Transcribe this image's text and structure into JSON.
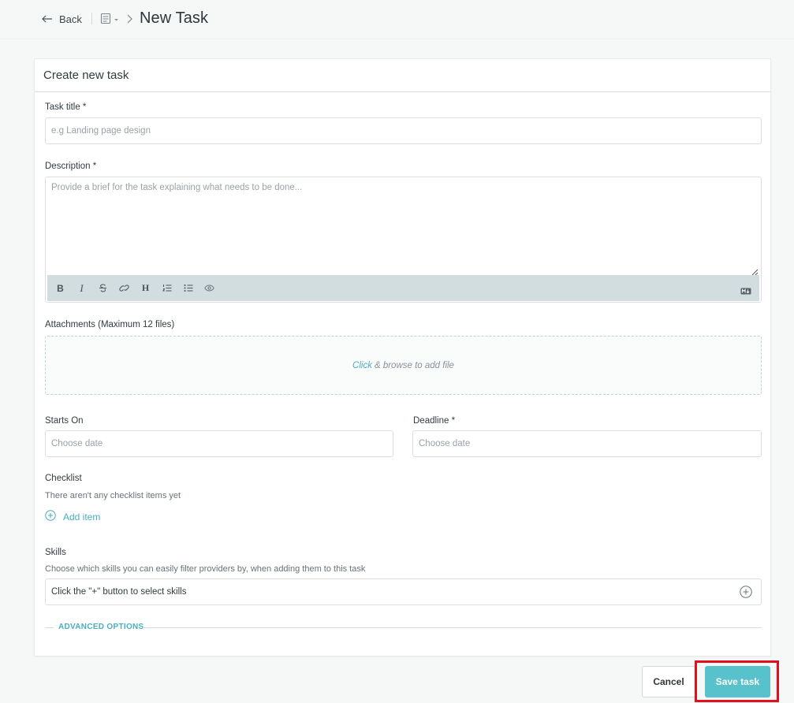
{
  "header": {
    "back_label": "Back",
    "title": "New Task"
  },
  "form": {
    "card_title": "Create new task",
    "task_title": {
      "label": "Task title *",
      "placeholder": "e.g Landing page design"
    },
    "description": {
      "label": "Description *",
      "placeholder": "Provide a brief for the task explaining what needs to be done...",
      "toolbar": {
        "bold": "B",
        "italic": "I",
        "heading": "H"
      }
    },
    "attachments": {
      "label": "Attachments (Maximum 12 files)",
      "click": "Click",
      "browse": "& browse to add file"
    },
    "starts_on": {
      "label": "Starts On",
      "placeholder": "Choose date"
    },
    "deadline": {
      "label": "Deadline *",
      "placeholder": "Choose date"
    },
    "checklist": {
      "label": "Checklist",
      "empty": "There aren't any checklist items yet",
      "add_item": "Add item"
    },
    "skills": {
      "label": "Skills",
      "help": "Choose which skills you can easily filter providers by, when adding them to this task",
      "value": "Click the \"+\" button to select skills"
    },
    "advanced_options": "ADVANCED OPTIONS"
  },
  "actions": {
    "cancel": "Cancel",
    "save": "Save task"
  },
  "colors": {
    "accent": "#57c1cc",
    "link": "#4aaec0",
    "toolbar_bg": "#d2dde0",
    "highlight": "#e0101c"
  }
}
